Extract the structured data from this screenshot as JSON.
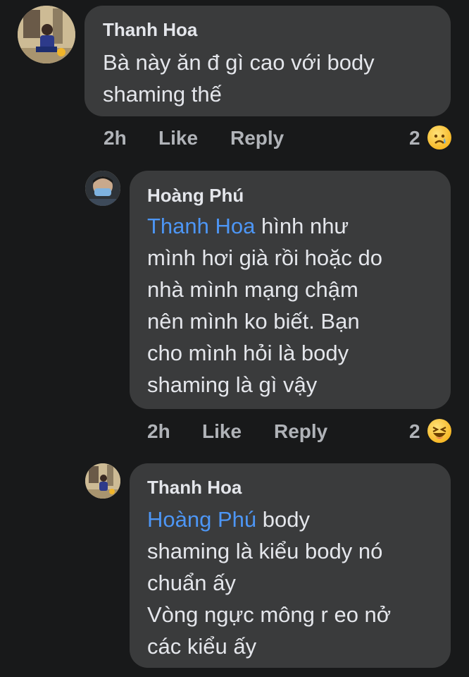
{
  "comments": [
    {
      "author": "Thanh Hoa",
      "text": "Bà này ăn đ gì cao với body\nshaming thế",
      "time": "2h",
      "like_label": "Like",
      "reply_label": "Reply",
      "reaction_count": "2",
      "reaction_icon": "sad-emoji-icon"
    },
    {
      "author": "Hoàng Phú",
      "mention": "Thanh Hoa",
      "text": " hình như\nmình hơi già rồi hoặc do\nnhà mình mạng chậm\nnên mình ko biết. Bạn\ncho mình hỏi là body\nshaming là gì vậy",
      "time": "2h",
      "like_label": "Like",
      "reply_label": "Reply",
      "reaction_count": "2",
      "reaction_icon": "laugh-emoji-icon"
    },
    {
      "author": "Thanh Hoa",
      "mention": "Hoàng Phú",
      "text": "  body\nshaming là kiểu body nó\nchuẩn ấy\nVòng ngực mông r eo nở\ncác kiểu ấy"
    }
  ],
  "colors": {
    "background": "#18191a",
    "bubble": "#3a3b3c",
    "mention": "#4d96f5",
    "secondary_text": "#b0b3b8"
  }
}
